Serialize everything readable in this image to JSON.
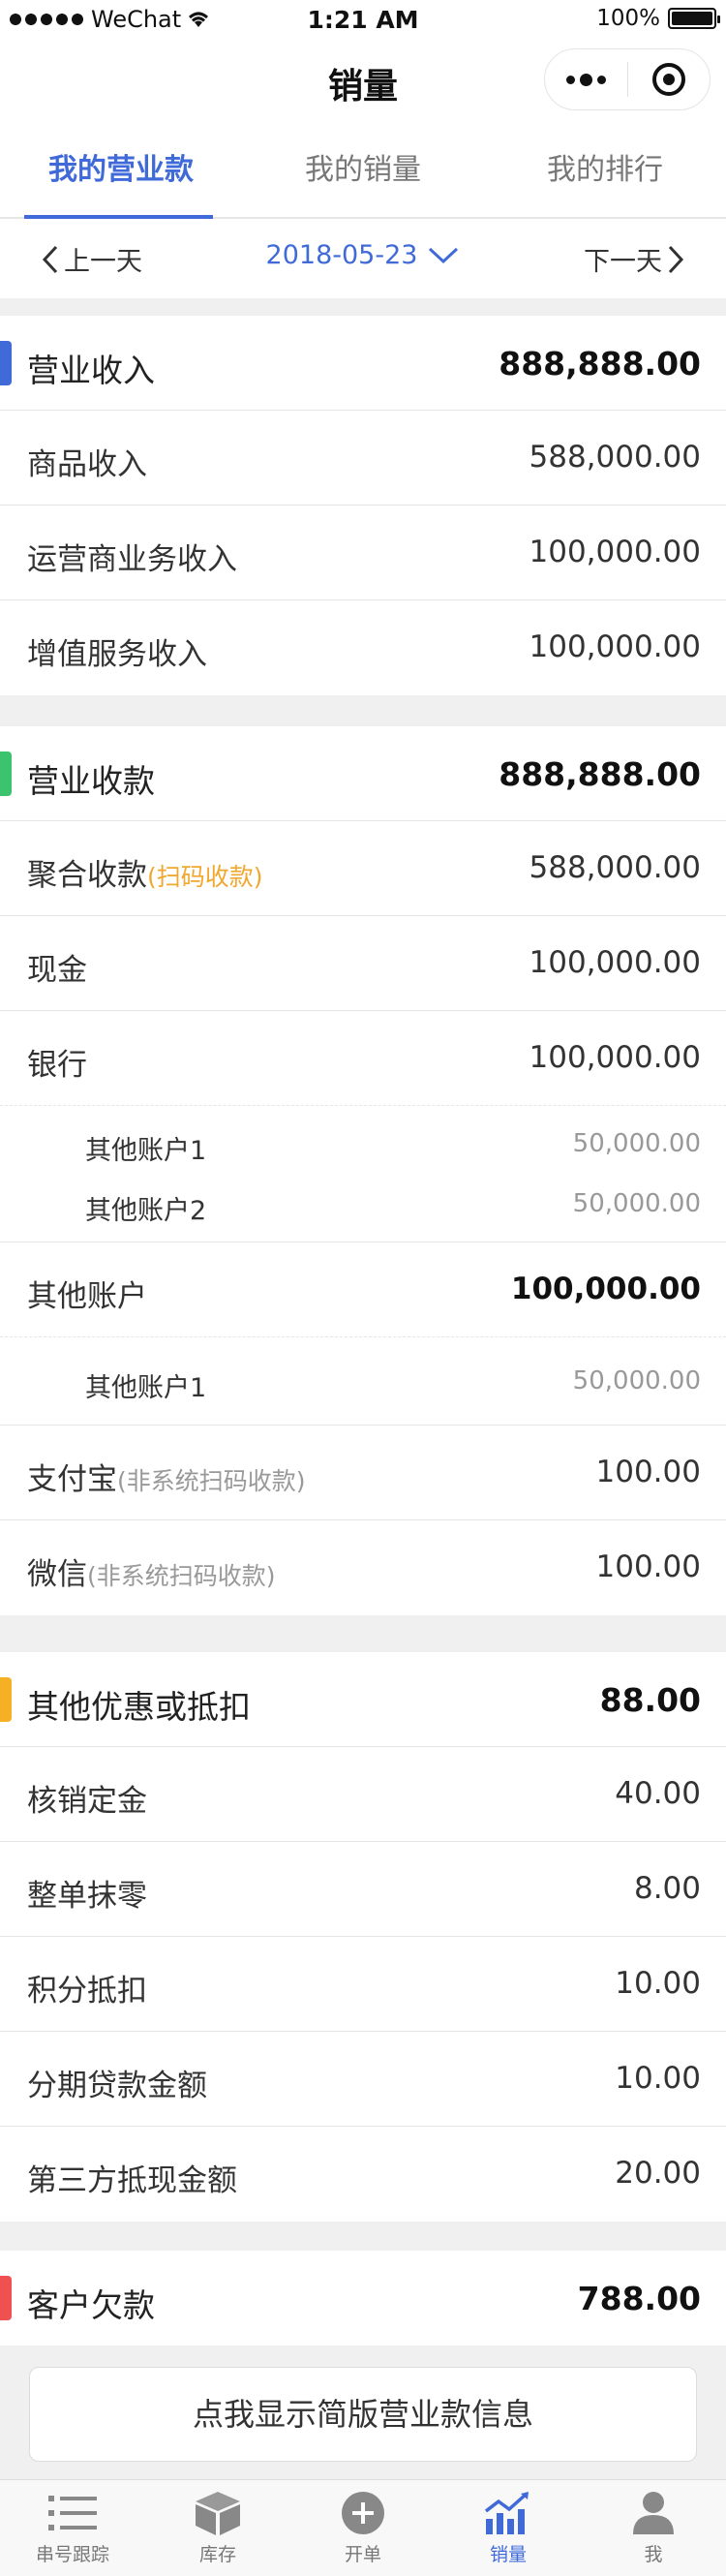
{
  "status_bar": {
    "carrier": "WeChat",
    "time": "1:21 AM",
    "battery": "100%",
    "battery_level": 1.0
  },
  "nav": {
    "title": "销量"
  },
  "tabs": [
    {
      "label": "我的营业款",
      "active": true
    },
    {
      "label": "我的销量",
      "active": false
    },
    {
      "label": "我的排行",
      "active": false
    }
  ],
  "date_bar": {
    "prev": "上一天",
    "date": "2018-05-23",
    "next": "下一天"
  },
  "revenue": {
    "title": "营业收入",
    "total": "888,888.00",
    "color": "#3f6ad8",
    "rows": [
      {
        "label": "商品收入",
        "value": "588,000.00"
      },
      {
        "label": "运营商业务收入",
        "value": "100,000.00"
      },
      {
        "label": "增值服务收入",
        "value": "100,000.00"
      }
    ]
  },
  "collection": {
    "title": "营业收款",
    "total": "888,888.00",
    "color": "#3cc36e",
    "juhe": {
      "label": "聚合收款",
      "note": "(扫码收款)",
      "value": "588,000.00"
    },
    "cash": {
      "label": "现金",
      "value": "100,000.00"
    },
    "bank": {
      "label": "银行",
      "value": "100,000.00",
      "sub": [
        {
          "label": "其他账户1",
          "value": "50,000.00"
        },
        {
          "label": "其他账户2",
          "value": "50,000.00"
        }
      ]
    },
    "other": {
      "label": "其他账户",
      "value": "100,000.00",
      "sub": [
        {
          "label": "其他账户1",
          "value": "50,000.00"
        }
      ]
    },
    "alipay": {
      "label": "支付宝",
      "note": "(非系统扫码收款)",
      "value": "100.00"
    },
    "wechat": {
      "label": "微信",
      "note": "(非系统扫码收款)",
      "value": "100.00"
    }
  },
  "discount": {
    "title": "其他优惠或抵扣",
    "total": "88.00",
    "color": "#f5b026",
    "rows": [
      {
        "label": "核销定金",
        "value": "40.00"
      },
      {
        "label": "整单抹零",
        "value": "8.00"
      },
      {
        "label": "积分抵扣",
        "value": "10.00"
      },
      {
        "label": "分期贷款金额",
        "value": "10.00"
      },
      {
        "label": "第三方抵现金额",
        "value": "20.00"
      }
    ]
  },
  "debt": {
    "title": "客户欠款",
    "total": "788.00",
    "color": "#ef5050"
  },
  "simple_button": "点我显示简版营业款信息",
  "tabbar": [
    {
      "label": "串号跟踪",
      "icon": "list-icon",
      "active": false
    },
    {
      "label": "库存",
      "icon": "box-icon",
      "active": false
    },
    {
      "label": "开单",
      "icon": "plus-circle-icon",
      "active": false
    },
    {
      "label": "销量",
      "icon": "chart-icon",
      "active": true
    },
    {
      "label": "我",
      "icon": "person-icon",
      "active": false
    }
  ]
}
